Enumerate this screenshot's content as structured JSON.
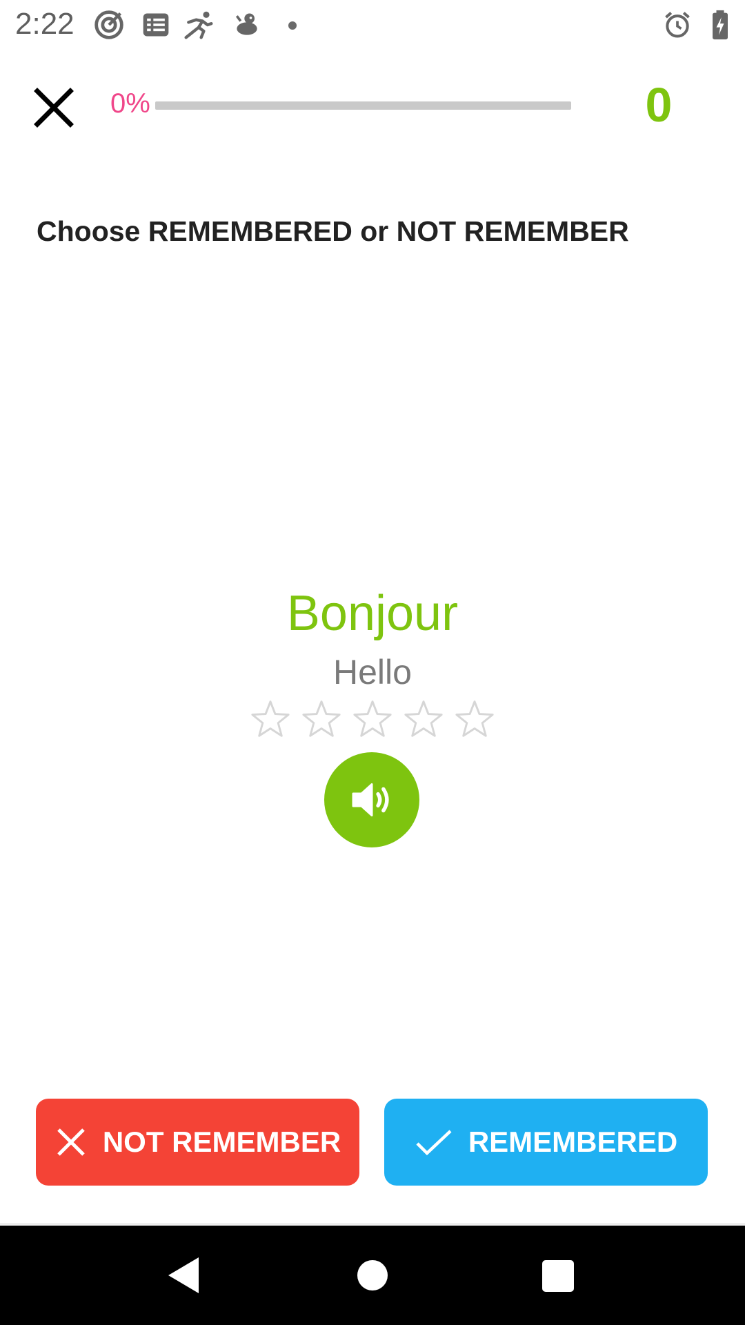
{
  "status_bar": {
    "time": "2:22",
    "icons": [
      "target-icon",
      "list-icon",
      "runner-icon",
      "animal-icon",
      "dot-icon",
      "alarm-icon",
      "battery-charging-icon"
    ]
  },
  "header": {
    "progress_label": "0%",
    "progress_value": 0,
    "score": "0"
  },
  "instruction": "Choose REMEMBERED or NOT REMEMBER",
  "card": {
    "word": "Bonjour",
    "meaning": "Hello",
    "rating": 0,
    "rating_max": 5
  },
  "actions": {
    "not_remember_label": "NOT REMEMBER",
    "remembered_label": "REMEMBERED"
  },
  "colors": {
    "accent_green": "#7ec40f",
    "progress_pink": "#f0478a",
    "not_remember_red": "#f44336",
    "remembered_blue": "#1fb0f2"
  }
}
